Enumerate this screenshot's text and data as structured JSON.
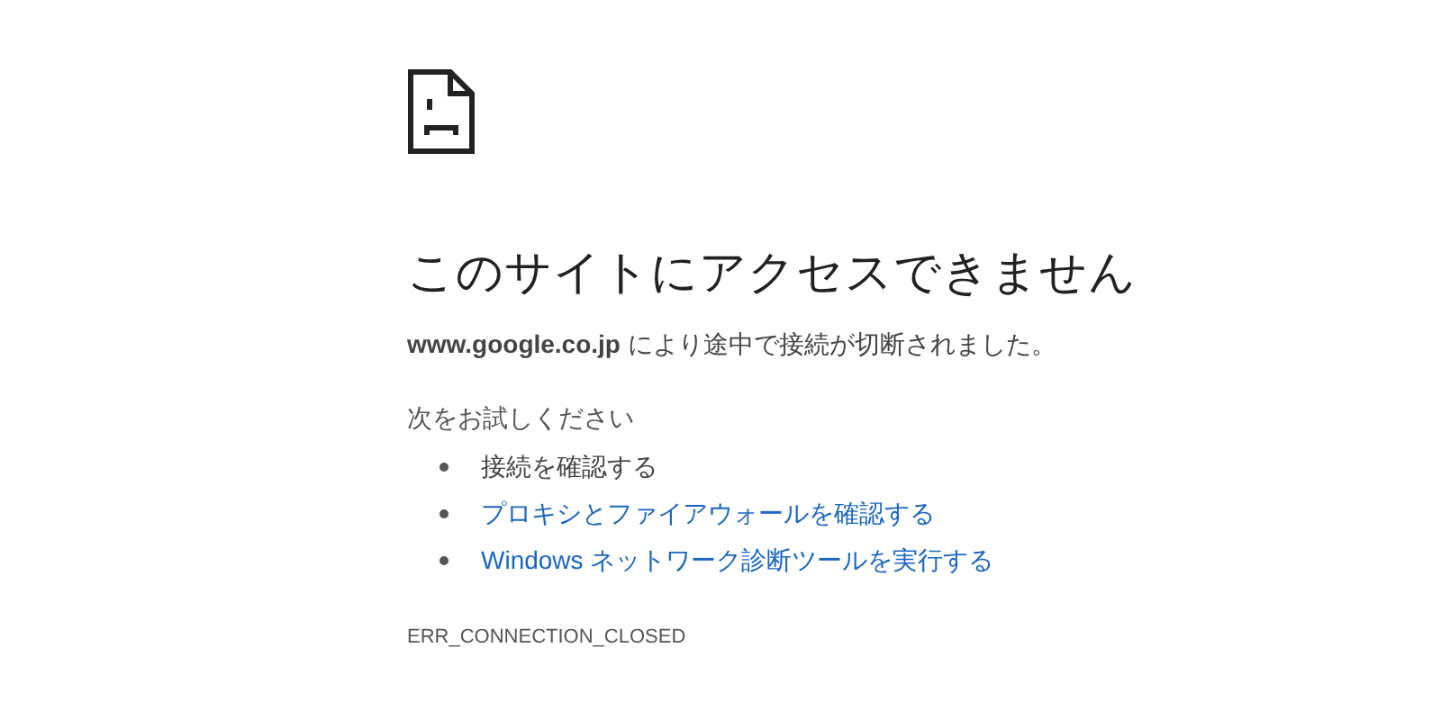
{
  "heading": "このサイトにアクセスできません",
  "message": "**www.google.co.jp** により途中で接続が切断されました。",
  "suggestions": {
    "title": "次をお試しください",
    "items": [
      {
        "kind": "text",
        "label": "接続を確認する"
      },
      {
        "kind": "link",
        "label": "プロキシとファイアウォールを確認する"
      },
      {
        "kind": "link",
        "label": "Windows ネットワーク診断ツールを実行する"
      }
    ]
  },
  "error_code": "ERR_CONNECTION_CLOSED"
}
